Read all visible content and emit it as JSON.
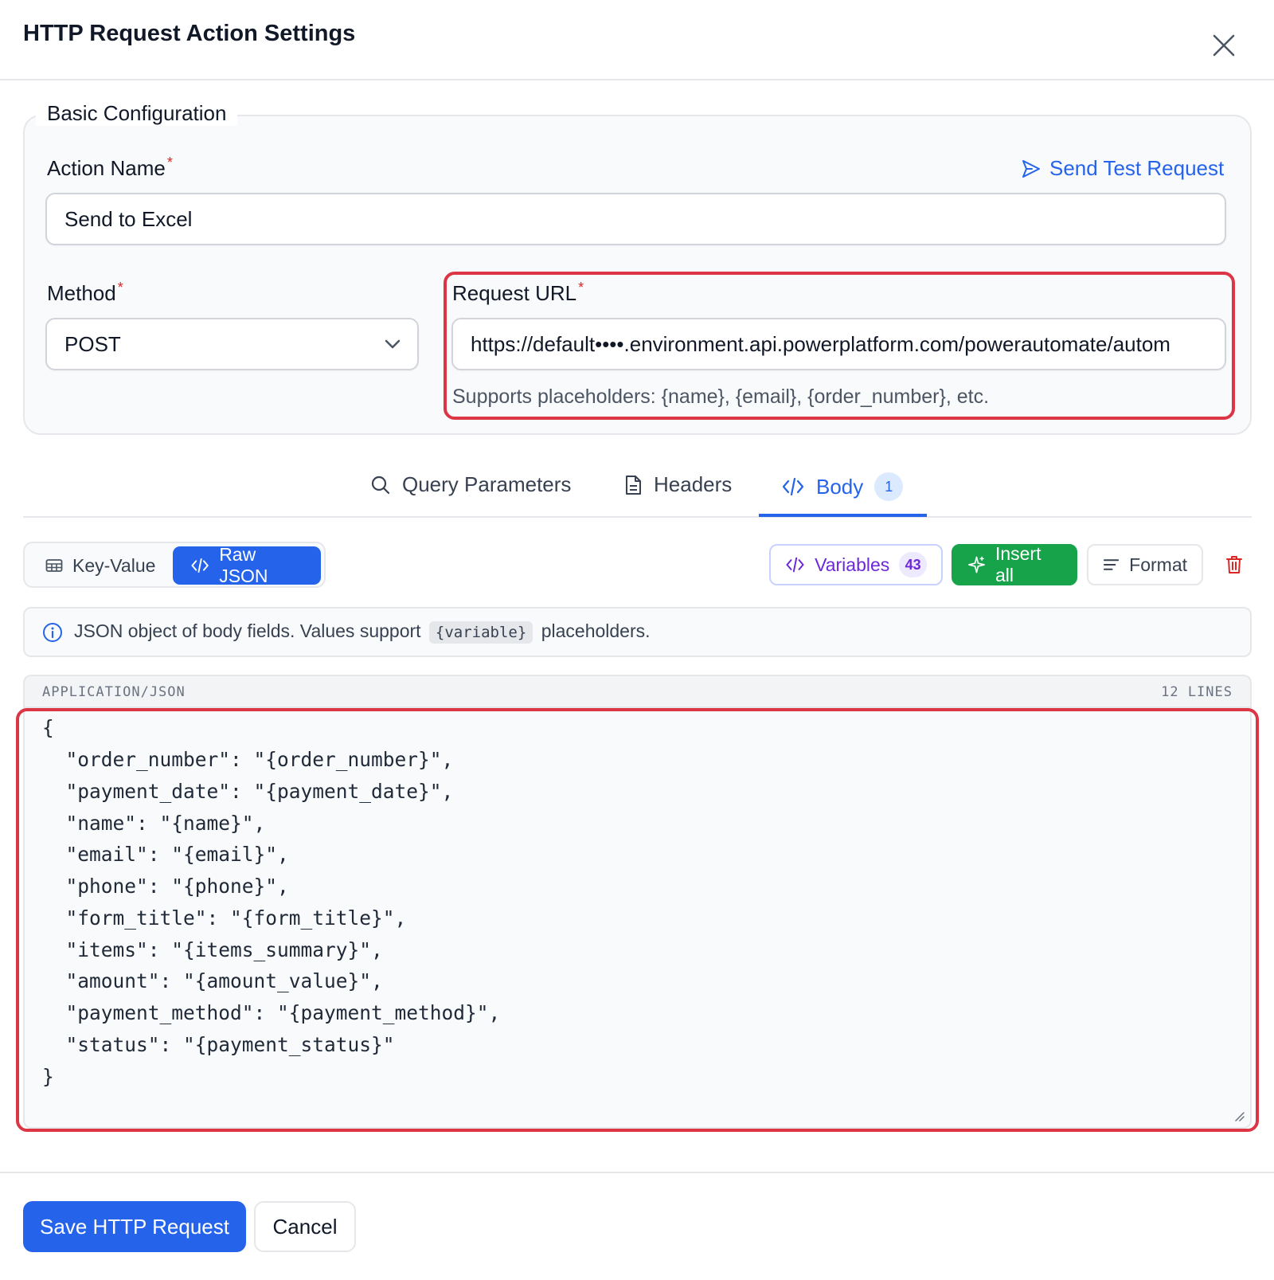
{
  "dialog": {
    "title": "HTTP Request Action Settings"
  },
  "basic": {
    "legend": "Basic Configuration",
    "action_name_label": "Action Name",
    "action_name_value": "Send to Excel",
    "send_test_label": "Send Test Request",
    "method_label": "Method",
    "method_value": "POST",
    "url_label": "Request URL",
    "url_value": "https://default••••.environment.api.powerplatform.com/powerautomate/autom",
    "url_hint": "Supports placeholders: {name}, {email}, {order_number}, etc.",
    "required_mark": "*"
  },
  "tabs": [
    {
      "label": "Query Parameters",
      "icon": "search-icon",
      "active": false
    },
    {
      "label": "Headers",
      "icon": "document-icon",
      "active": false
    },
    {
      "label": "Body",
      "icon": "code-icon",
      "active": true,
      "badge": "1"
    }
  ],
  "toolbar": {
    "key_value_label": "Key-Value",
    "raw_json_label": "Raw JSON",
    "variables_label": "Variables",
    "variables_count": "43",
    "insert_all_label": "Insert all",
    "format_label": "Format"
  },
  "info": {
    "text_before": "JSON object of body fields. Values support",
    "code": "{variable}",
    "text_after": "placeholders."
  },
  "editor": {
    "content_type": "APPLICATION/JSON",
    "line_count": "12 LINES",
    "lines": [
      "{",
      "  \"order_number\": \"{order_number}\",",
      "  \"payment_date\": \"{payment_date}\",",
      "  \"name\": \"{name}\",",
      "  \"email\": \"{email}\",",
      "  \"phone\": \"{phone}\",",
      "  \"form_title\": \"{form_title}\",",
      "  \"items\": \"{items_summary}\",",
      "  \"amount\": \"{amount_value}\",",
      "  \"payment_method\": \"{payment_method}\",",
      "  \"status\": \"{payment_status}\"",
      "}"
    ]
  },
  "footer": {
    "save_label": "Save HTTP Request",
    "cancel_label": "Cancel"
  },
  "colors": {
    "primary": "#2563eb",
    "success": "#16a34a",
    "danger": "#dc2626",
    "highlight": "#dc3545",
    "variables": "#6d28d9"
  }
}
